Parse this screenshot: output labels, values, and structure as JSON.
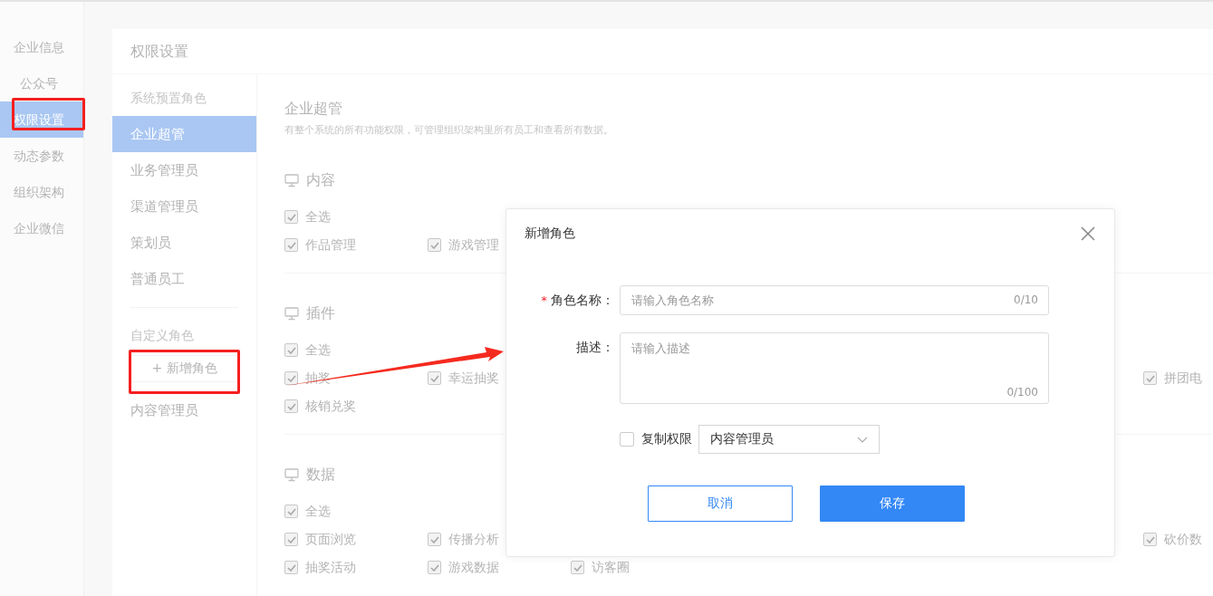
{
  "sidebar": {
    "items": [
      {
        "label": "企业信息",
        "selected": false,
        "indent": false
      },
      {
        "label": "公众号",
        "selected": false,
        "indent": true
      },
      {
        "label": "权限设置",
        "selected": true,
        "indent": false
      },
      {
        "label": "动态参数",
        "selected": false,
        "indent": false
      },
      {
        "label": "组织架构",
        "selected": false,
        "indent": false
      },
      {
        "label": "企业微信",
        "selected": false,
        "indent": false
      }
    ]
  },
  "panel": {
    "title": "权限设置"
  },
  "roles": {
    "preset_label": "系统预置角色",
    "preset": [
      {
        "label": "企业超管",
        "selected": true
      },
      {
        "label": "业务管理员",
        "selected": false
      },
      {
        "label": "渠道管理员",
        "selected": false
      },
      {
        "label": "策划员",
        "selected": false
      },
      {
        "label": "普通员工",
        "selected": false
      }
    ],
    "custom_label": "自定义角色",
    "add_button": "+ 新增角色",
    "custom": [
      {
        "label": "内容管理员",
        "selected": false
      }
    ]
  },
  "detail": {
    "title": "企业超管",
    "description": "有整个系统的所有功能权限，可管理组织架构里所有员工和查看所有数据。",
    "sections": [
      {
        "title": "内容",
        "rows": [
          {
            "items": [
              {
                "label": "全选",
                "checked": true
              }
            ]
          },
          {
            "items": [
              {
                "label": "作品管理",
                "checked": true
              },
              {
                "label": "游戏管理",
                "checked": true
              }
            ]
          }
        ]
      },
      {
        "title": "插件",
        "rows": [
          {
            "items": [
              {
                "label": "全选",
                "checked": true
              }
            ]
          },
          {
            "items": [
              {
                "label": "抽奖",
                "checked": true
              },
              {
                "label": "幸运抽奖",
                "checked": true
              }
            ],
            "end_item": {
              "label": "拼团电",
              "checked": true
            }
          },
          {
            "items": [
              {
                "label": "核销兑奖",
                "checked": true
              }
            ]
          }
        ]
      },
      {
        "title": "数据",
        "rows": [
          {
            "items": [
              {
                "label": "全选",
                "checked": true
              }
            ]
          },
          {
            "items": [
              {
                "label": "页面浏览",
                "checked": true
              },
              {
                "label": "传播分析",
                "checked": true
              }
            ],
            "end_item": {
              "label": "砍价数",
              "checked": true
            }
          },
          {
            "items": [
              {
                "label": "抽奖活动",
                "checked": true
              },
              {
                "label": "游戏数据",
                "checked": true
              },
              {
                "label": "访客圈",
                "checked": true
              }
            ]
          }
        ]
      }
    ]
  },
  "dialog": {
    "title": "新增角色",
    "name_field": {
      "label": "角色名称：",
      "required_mark": "*",
      "placeholder": "请输入角色名称",
      "counter": "0/10"
    },
    "description_field": {
      "label": "描述：",
      "placeholder": "请输入描述",
      "counter": "0/100"
    },
    "copy": {
      "label": "复制权限",
      "checked": false,
      "value": "内容管理员"
    },
    "buttons": [
      {
        "label": "取消",
        "kind": "secondary"
      },
      {
        "label": "保存",
        "kind": "primary"
      }
    ]
  }
}
